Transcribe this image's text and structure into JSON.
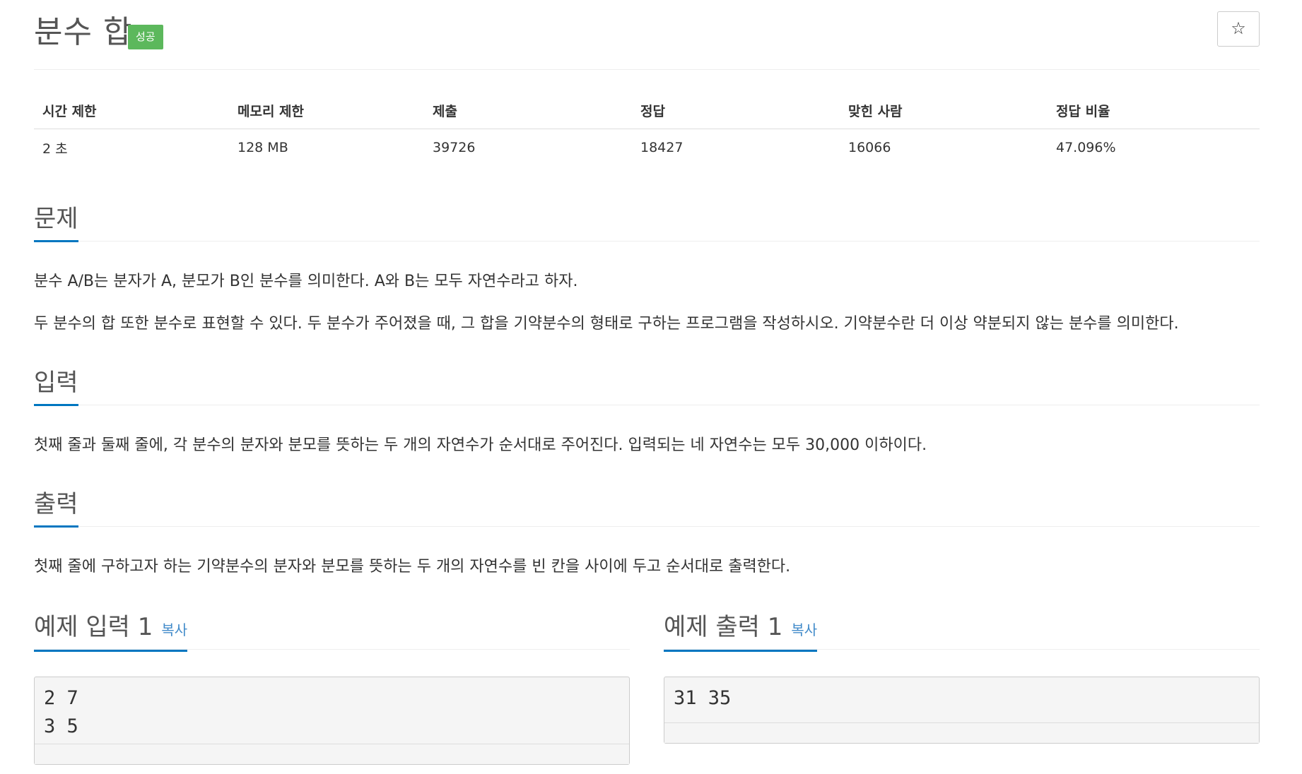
{
  "header": {
    "title": "분수 합",
    "badge": "성공",
    "star_icon": "☆"
  },
  "info_table": {
    "headers": [
      "시간 제한",
      "메모리 제한",
      "제출",
      "정답",
      "맞힌 사람",
      "정답 비율"
    ],
    "values": [
      "2 초",
      "128 MB",
      "39726",
      "18427",
      "16066",
      "47.096%"
    ]
  },
  "problem": {
    "heading": "문제",
    "paragraphs": [
      "분수 A/B는 분자가 A, 분모가 B인 분수를 의미한다. A와 B는 모두 자연수라고 하자.",
      "두 분수의 합 또한 분수로 표현할 수 있다. 두 분수가 주어졌을 때, 그 합을 기약분수의 형태로 구하는 프로그램을 작성하시오. 기약분수란 더 이상 약분되지 않는 분수를 의미한다."
    ]
  },
  "input": {
    "heading": "입력",
    "text": "첫째 줄과 둘째 줄에, 각 분수의 분자와 분모를 뜻하는 두 개의 자연수가 순서대로 주어진다. 입력되는 네 자연수는 모두 30,000 이하이다."
  },
  "output": {
    "heading": "출력",
    "text": "첫째 줄에 구하고자 하는 기약분수의 분자와 분모를 뜻하는 두 개의 자연수를 빈 칸을 사이에 두고 순서대로 출력한다."
  },
  "sample_input": {
    "heading": "예제 입력 1",
    "copy_label": "복사",
    "lines": [
      "2 7",
      "3 5"
    ]
  },
  "sample_output": {
    "heading": "예제 출력 1",
    "copy_label": "복사",
    "lines": [
      "31 35"
    ]
  }
}
